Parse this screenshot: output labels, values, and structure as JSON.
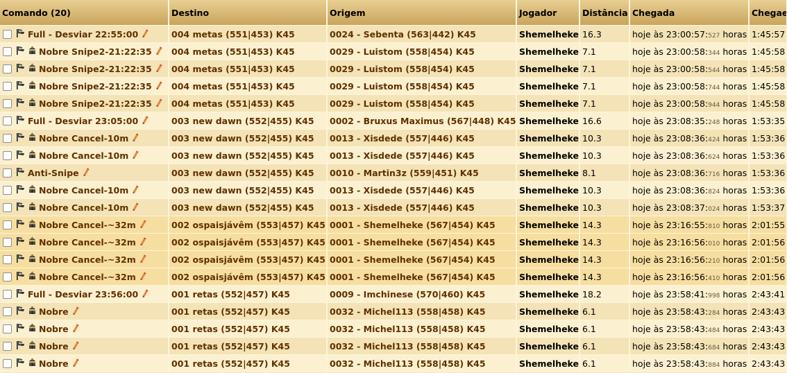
{
  "headers": {
    "comando": "Comando (20)",
    "destino": "Destino",
    "origem": "Origem",
    "jogador": "Jogador",
    "distancia": "Distância",
    "chegada": "Chegada",
    "chega_em": "Chegaem"
  },
  "rows": [
    {
      "command": "Full - Desviar 22:55:00",
      "dest": "004 metas (551|453) K45",
      "origin": "0024 - Sebenta (563|442) K45",
      "player": "Shemelheke",
      "dist": "16.3",
      "arr_main": "hoje às 23:00:57:",
      "arr_ms": "527",
      "arr_suffix": " horas",
      "eta": "1:45:57"
    },
    {
      "command": "Nobre Snipe2-21:22:35",
      "dest": "004 metas (551|453) K45",
      "origin": "0029 - Luistom (558|454) K45",
      "player": "Shemelheke",
      "dist": "7.1",
      "arr_main": "hoje às 23:00:58:",
      "arr_ms": "344",
      "arr_suffix": " horas",
      "eta": "1:45:58"
    },
    {
      "command": "Nobre Snipe2-21:22:35",
      "dest": "004 metas (551|453) K45",
      "origin": "0029 - Luistom (558|454) K45",
      "player": "Shemelheke",
      "dist": "7.1",
      "arr_main": "hoje às 23:00:58:",
      "arr_ms": "544",
      "arr_suffix": " horas",
      "eta": "1:45:58"
    },
    {
      "command": "Nobre Snipe2-21:22:35",
      "dest": "004 metas (551|453) K45",
      "origin": "0029 - Luistom (558|454) K45",
      "player": "Shemelheke",
      "dist": "7.1",
      "arr_main": "hoje às 23:00:58:",
      "arr_ms": "744",
      "arr_suffix": " horas",
      "eta": "1:45:58"
    },
    {
      "command": "Nobre Snipe2-21:22:35",
      "dest": "004 metas (551|453) K45",
      "origin": "0029 - Luistom (558|454) K45",
      "player": "Shemelheke",
      "dist": "7.1",
      "arr_main": "hoje às 23:00:58:",
      "arr_ms": "944",
      "arr_suffix": " horas",
      "eta": "1:45:58"
    },
    {
      "command": "Full - Desviar 23:05:00",
      "dest": "003 new dawn (552|455) K45",
      "origin": "0002 - Bruxus Maximus (567|448) K45",
      "player": "Shemelheke",
      "dist": "16.6",
      "arr_main": "hoje às 23:08:35:",
      "arr_ms": "248",
      "arr_suffix": " horas",
      "eta": "1:53:35"
    },
    {
      "command": "Nobre Cancel-10m",
      "dest": "003 new dawn (552|455) K45",
      "origin": "0013 - Xisdede (557|446) K45",
      "player": "Shemelheke",
      "dist": "10.3",
      "arr_main": "hoje às 23:08:36:",
      "arr_ms": "424",
      "arr_suffix": " horas",
      "eta": "1:53:36"
    },
    {
      "command": "Nobre Cancel-10m",
      "dest": "003 new dawn (552|455) K45",
      "origin": "0013 - Xisdede (557|446) K45",
      "player": "Shemelheke",
      "dist": "10.3",
      "arr_main": "hoje às 23:08:36:",
      "arr_ms": "624",
      "arr_suffix": " horas",
      "eta": "1:53:36"
    },
    {
      "command": "Anti-Snipe",
      "dest": "003 new dawn (552|455) K45",
      "origin": "0010 - Martin3z (559|451) K45",
      "player": "Shemelheke",
      "dist": "8.1",
      "arr_main": "hoje às 23:08:36:",
      "arr_ms": "716",
      "arr_suffix": " horas",
      "eta": "1:53:36"
    },
    {
      "command": "Nobre Cancel-10m",
      "dest": "003 new dawn (552|455) K45",
      "origin": "0013 - Xisdede (557|446) K45",
      "player": "Shemelheke",
      "dist": "10.3",
      "arr_main": "hoje às 23:08:36:",
      "arr_ms": "824",
      "arr_suffix": " horas",
      "eta": "1:53:36"
    },
    {
      "command": "Nobre Cancel-10m",
      "dest": "003 new dawn (552|455) K45",
      "origin": "0013 - Xisdede (557|446) K45",
      "player": "Shemelheke",
      "dist": "10.3",
      "arr_main": "hoje às 23:08:37:",
      "arr_ms": "024",
      "arr_suffix": " horas",
      "eta": "1:53:37"
    },
    {
      "command": "Nobre Cancel-~32m",
      "dest": "002 ospaisjávêm (553|457) K45",
      "origin": "0001 - Shemelheke (567|454) K45",
      "player": "Shemelheke",
      "dist": "14.3",
      "arr_main": "hoje às 23:16:55:",
      "arr_ms": "810",
      "arr_suffix": " horas",
      "eta": "2:01:55"
    },
    {
      "command": "Nobre Cancel-~32m",
      "dest": "002 ospaisjávêm (553|457) K45",
      "origin": "0001 - Shemelheke (567|454) K45",
      "player": "Shemelheke",
      "dist": "14.3",
      "arr_main": "hoje às 23:16:56:",
      "arr_ms": "010",
      "arr_suffix": " horas",
      "eta": "2:01:56"
    },
    {
      "command": "Nobre Cancel-~32m",
      "dest": "002 ospaisjávêm (553|457) K45",
      "origin": "0001 - Shemelheke (567|454) K45",
      "player": "Shemelheke",
      "dist": "14.3",
      "arr_main": "hoje às 23:16:56:",
      "arr_ms": "210",
      "arr_suffix": " horas",
      "eta": "2:01:56"
    },
    {
      "command": "Nobre Cancel-~32m",
      "dest": "002 ospaisjávêm (553|457) K45",
      "origin": "0001 - Shemelheke (567|454) K45",
      "player": "Shemelheke",
      "dist": "14.3",
      "arr_main": "hoje às 23:16:56:",
      "arr_ms": "410",
      "arr_suffix": " horas",
      "eta": "2:01:56"
    },
    {
      "command": "Full - Desviar 23:56:00",
      "dest": "001 retas (552|457) K45",
      "origin": "0009 - Imchinese (570|460) K45",
      "player": "Shemelheke",
      "dist": "18.2",
      "arr_main": "hoje às 23:58:41:",
      "arr_ms": "998",
      "arr_suffix": " horas",
      "eta": "2:43:41"
    },
    {
      "command": "Nobre",
      "dest": "001 retas (552|457) K45",
      "origin": "0032 - Michel113 (558|458) K45",
      "player": "Shemelheke",
      "dist": "6.1",
      "arr_main": "hoje às 23:58:43:",
      "arr_ms": "284",
      "arr_suffix": " horas",
      "eta": "2:43:43"
    },
    {
      "command": "Nobre",
      "dest": "001 retas (552|457) K45",
      "origin": "0032 - Michel113 (558|458) K45",
      "player": "Shemelheke",
      "dist": "6.1",
      "arr_main": "hoje às 23:58:43:",
      "arr_ms": "484",
      "arr_suffix": " horas",
      "eta": "2:43:43"
    },
    {
      "command": "Nobre",
      "dest": "001 retas (552|457) K45",
      "origin": "0032 - Michel113 (558|458) K45",
      "player": "Shemelheke",
      "dist": "6.1",
      "arr_main": "hoje às 23:58:43:",
      "arr_ms": "684",
      "arr_suffix": " horas",
      "eta": "2:43:43"
    },
    {
      "command": "Nobre",
      "dest": "001 retas (552|457) K45",
      "origin": "0032 - Michel113 (558|458) K45",
      "player": "Shemelheke",
      "dist": "6.1",
      "arr_main": "hoje às 23:58:43:",
      "arr_ms": "884",
      "arr_suffix": " horas",
      "eta": "2:43:43"
    }
  ],
  "icons": {
    "attack": "attack-flag-icon",
    "noble": "noble-helmet-icon",
    "rename": "pencil-icon"
  },
  "colors": {
    "header": "#d4b272",
    "row_even": "#f3e3b6",
    "row_odd": "#fbf0cf",
    "row_highlight": "#f6dea0",
    "link": "#603000"
  }
}
